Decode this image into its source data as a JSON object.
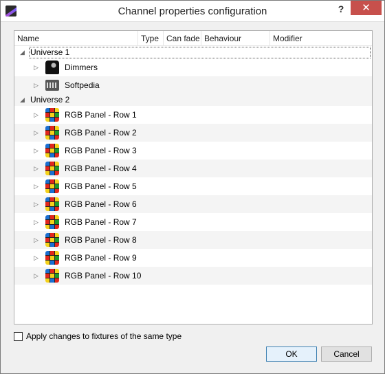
{
  "window": {
    "title": "Channel properties configuration",
    "help_glyph": "?",
    "close_glyph": "✕"
  },
  "columns": [
    "Name",
    "Type",
    "Can fade",
    "Behaviour",
    "Modifier"
  ],
  "universes": [
    {
      "label": "Universe 1",
      "items": [
        {
          "label": "Dimmers",
          "icon": "dimmer-icon"
        },
        {
          "label": "Softpedia",
          "icon": "led-panel-icon"
        }
      ]
    },
    {
      "label": "Universe 2",
      "items": [
        {
          "label": "RGB Panel - Row 1",
          "icon": "rgb-cube-icon"
        },
        {
          "label": "RGB Panel - Row 2",
          "icon": "rgb-cube-icon"
        },
        {
          "label": "RGB Panel - Row 3",
          "icon": "rgb-cube-icon"
        },
        {
          "label": "RGB Panel - Row 4",
          "icon": "rgb-cube-icon"
        },
        {
          "label": "RGB Panel - Row 5",
          "icon": "rgb-cube-icon"
        },
        {
          "label": "RGB Panel - Row 6",
          "icon": "rgb-cube-icon"
        },
        {
          "label": "RGB Panel - Row 7",
          "icon": "rgb-cube-icon"
        },
        {
          "label": "RGB Panel - Row 8",
          "icon": "rgb-cube-icon"
        },
        {
          "label": "RGB Panel - Row 9",
          "icon": "rgb-cube-icon"
        },
        {
          "label": "RGB Panel - Row 10",
          "icon": "rgb-cube-icon"
        }
      ]
    }
  ],
  "footer": {
    "apply_checkbox_label": "Apply changes to fixtures of the same type",
    "apply_checked": false,
    "ok_label": "OK",
    "cancel_label": "Cancel"
  },
  "colors": {
    "close_button": "#c7504c",
    "default_button_border": "#3c7fb1"
  }
}
